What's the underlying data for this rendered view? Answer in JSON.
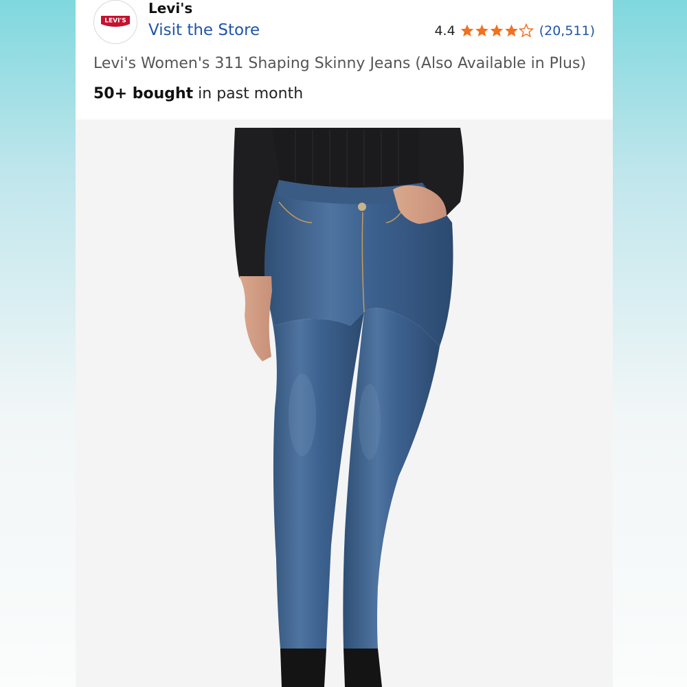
{
  "store": {
    "brand_name": "Levi's",
    "logo_text": "LEVI'S",
    "visit_store_label": "Visit the Store"
  },
  "rating": {
    "value": "4.4",
    "stars": 4.4,
    "max_stars": 5,
    "review_count": "(20,511)"
  },
  "product": {
    "title": "Levi's Women's 311 Shaping Skinny Jeans (Also Available in Plus)",
    "bought_bold": "50+ bought",
    "bought_rest": " in past month",
    "image_description": "product-photo-jeans"
  },
  "colors": {
    "link": "#1f54a8",
    "star": "#f3701f",
    "logo_red": "#c41230",
    "denim": "#3f6288"
  }
}
